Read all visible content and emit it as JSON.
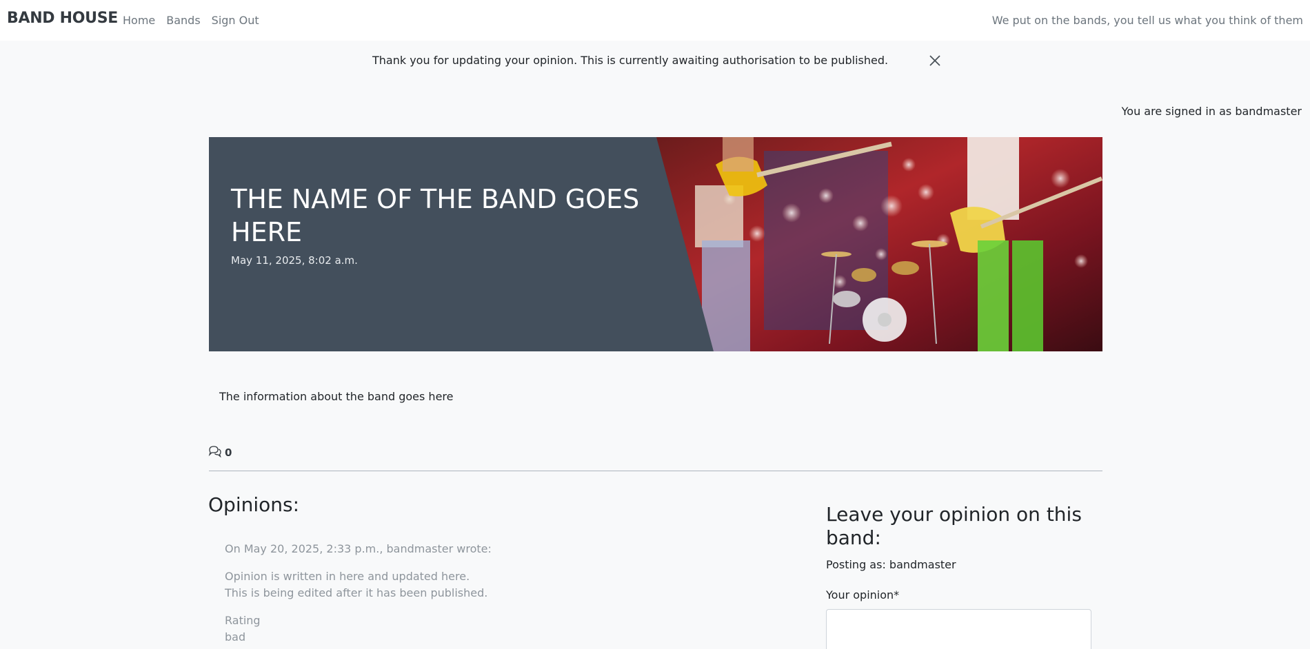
{
  "navbar": {
    "brand": "BAND HOUSE",
    "links": [
      "Home",
      "Bands",
      "Sign Out"
    ],
    "tagline": "We put on the bands, you tell us what you think of them"
  },
  "alert": {
    "message": "Thank you for updating your opinion. This is currently awaiting authorisation to be published.",
    "close_icon": "close-icon"
  },
  "user_status": "You are signed in as bandmaster",
  "band": {
    "name": "THE NAME OF THE BAND GOES HERE",
    "date": "May 11, 2025, 8:02 a.m.",
    "info": "The information about the band goes here",
    "hero_image": "concert-guitarists-drums-photo"
  },
  "comments": {
    "icon": "chat-bubbles-icon",
    "count": "0"
  },
  "opinions": {
    "heading": "Opinions:",
    "items": [
      {
        "meta": "On May 20, 2025, 2:33 p.m., bandmaster wrote:",
        "body_line1": "Opinion is written in here and updated here.",
        "body_line2": "This is being edited after it has been published.",
        "rating_label": "Rating",
        "rating_value": "bad"
      }
    ]
  },
  "form": {
    "heading": "Leave your opinion on this band:",
    "posting_as": "Posting as: bandmaster",
    "opinion_label": "Your opinion*",
    "opinion_value": ""
  },
  "colors": {
    "navbar_bg": "#ffffff",
    "page_bg": "#f8f9fa",
    "hero_panel": "#434f5c",
    "muted_text": "#6c757d"
  }
}
